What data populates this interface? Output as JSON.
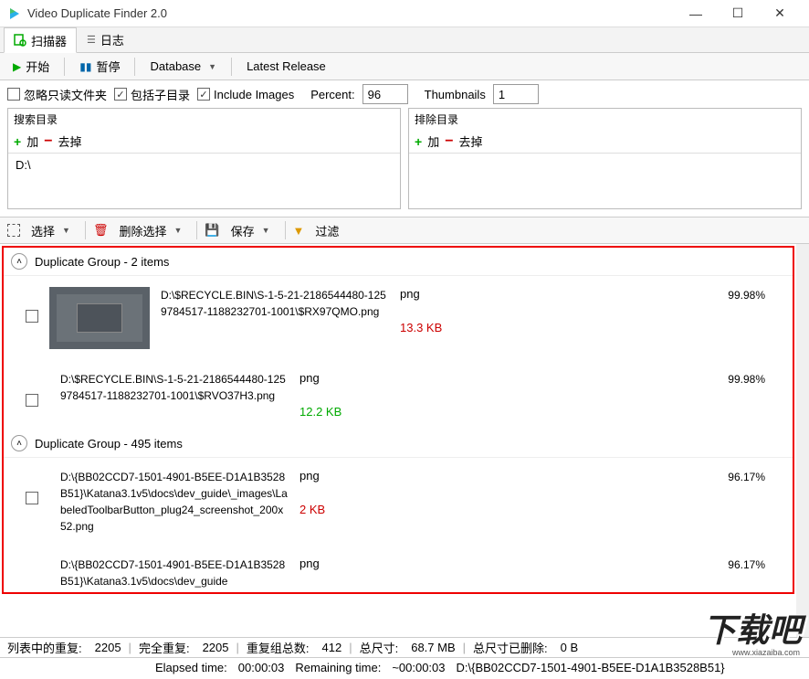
{
  "window": {
    "title": "Video Duplicate Finder 2.0"
  },
  "tabs": {
    "scanner": "扫描器",
    "log": "日志"
  },
  "toolbar": {
    "start": "开始",
    "pause": "暂停",
    "database": "Database",
    "latest_release": "Latest Release"
  },
  "options": {
    "ignore_readonly": "忽略只读文件夹",
    "include_subdirs": "包括子目录",
    "include_images": "Include Images",
    "percent_label": "Percent:",
    "percent_value": "96",
    "thumbnails_label": "Thumbnails",
    "thumbnails_value": "1"
  },
  "search_dirs": {
    "title": "搜索目录",
    "add": "加",
    "remove": "去掉",
    "items": [
      "D:\\"
    ]
  },
  "exclude_dirs": {
    "title": "排除目录",
    "add": "加",
    "remove": "去掉"
  },
  "actions": {
    "select": "选择",
    "delete_selected": "删除选择",
    "save": "保存",
    "filter": "过滤"
  },
  "groups": [
    {
      "title": "Duplicate Group - 2 items",
      "items": [
        {
          "has_thumb": true,
          "path": "D:\\$RECYCLE.BIN\\S-1-5-21-2186544480-1259784517-1188232701-1001\\$RX97QMO.png",
          "format": "png",
          "size": "13.3 KB",
          "size_class": "size-red",
          "similarity": "99.98%"
        },
        {
          "has_thumb": false,
          "path": "D:\\$RECYCLE.BIN\\S-1-5-21-2186544480-1259784517-1188232701-1001\\$RVO37H3.png",
          "format": "png",
          "size": "12.2 KB",
          "size_class": "size-green",
          "similarity": "99.98%"
        }
      ]
    },
    {
      "title": "Duplicate Group - 495 items",
      "items": [
        {
          "has_thumb": false,
          "path": "D:\\{BB02CCD7-1501-4901-B5EE-D1A1B3528B51}\\Katana3.1v5\\docs\\dev_guide\\_images\\LabeledToolbarButton_plug24_screenshot_200x52.png",
          "format": "png",
          "size": "2 KB",
          "size_class": "size-red",
          "similarity": "96.17%"
        },
        {
          "has_thumb": false,
          "path": "D:\\{BB02CCD7-1501-4901-B5EE-D1A1B3528B51}\\Katana3.1v5\\docs\\dev_guide",
          "format": "png",
          "size": "",
          "size_class": "",
          "similarity": "96.17%"
        }
      ]
    }
  ],
  "status1": {
    "list_dup_label": "列表中的重复:",
    "list_dup_value": "2205",
    "full_dup_label": "完全重复:",
    "full_dup_value": "2205",
    "group_total_label": "重复组总数:",
    "group_total_value": "412",
    "total_size_label": "总尺寸:",
    "total_size_value": "68.7 MB",
    "deleted_size_label": "总尺寸已删除:",
    "deleted_size_value": "0 B"
  },
  "status2": {
    "elapsed_label": "Elapsed time:",
    "elapsed_value": "00:00:03",
    "remaining_label": "Remaining time:",
    "remaining_value": "~00:00:03",
    "current_path": "D:\\{BB02CCD7-1501-4901-B5EE-D1A1B3528B51}"
  },
  "watermark": {
    "main": "下载吧",
    "sub": "www.xiazaiba.com"
  }
}
